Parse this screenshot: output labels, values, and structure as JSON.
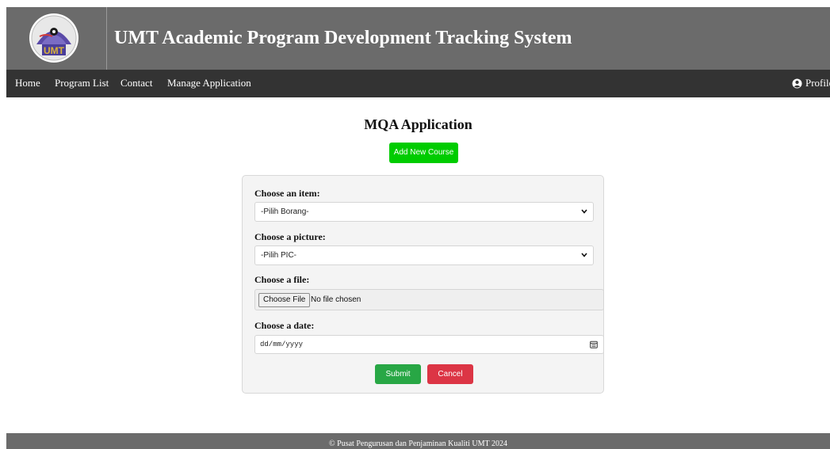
{
  "header": {
    "logo_text": "UMT",
    "title": "UMT Academic Program Development Tracking System"
  },
  "nav": {
    "items": [
      {
        "label": "Home"
      },
      {
        "label": "Program List"
      },
      {
        "label": "Contact"
      },
      {
        "label": "Manage Application"
      }
    ],
    "profile_label": "Profile",
    "profile_icon": "user-circle-icon"
  },
  "main": {
    "heading": "MQA Application",
    "add_button_label": "Add New Course"
  },
  "form": {
    "item_label": "Choose an item:",
    "item_selected": "-Pilih Borang-",
    "picture_label": "Choose a picture:",
    "picture_selected": "-Pilih PIC-",
    "file_label": "Choose a file:",
    "file_button_label": "Choose File",
    "file_status": "No file chosen",
    "date_label": "Choose a date:",
    "date_placeholder": "dd/mm/yyyy",
    "submit_label": "Submit",
    "cancel_label": "Cancel"
  },
  "footer": {
    "text": "© Pusat Pengurusan dan Penjaminan Kualiti UMT 2024"
  },
  "colors": {
    "header_bg": "#6b6b6b",
    "nav_bg": "#333333",
    "add_button": "#00cc00",
    "submit_button": "#28a745",
    "cancel_button": "#dc3545"
  }
}
